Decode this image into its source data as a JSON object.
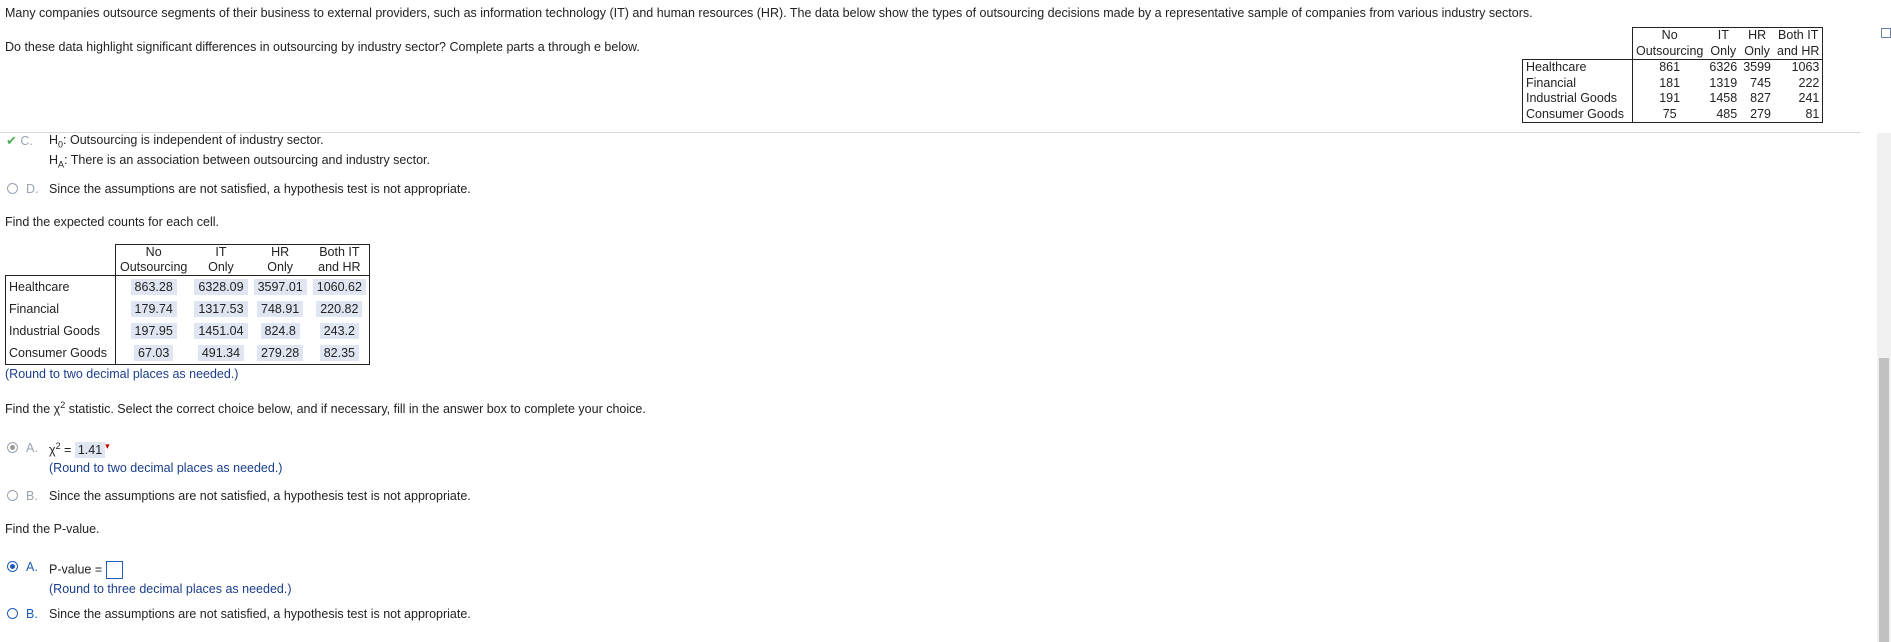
{
  "intro": "Many companies outsource segments of their business to external providers, such as information technology (IT) and human resources (HR). The data below show the types of outsourcing decisions made by a representative sample of companies from various industry sectors.",
  "question": "Do these data highlight significant differences in outsourcing by industry sector? Complete parts a through e below.",
  "data_table": {
    "headers": [
      [
        "No",
        "Outsourcing"
      ],
      [
        "IT",
        "Only"
      ],
      [
        "HR",
        "Only"
      ],
      [
        "Both IT",
        "and HR"
      ]
    ],
    "rows": [
      {
        "label": "Healthcare",
        "values": [
          "861",
          "6326",
          "3599",
          "1063"
        ]
      },
      {
        "label": "Financial",
        "values": [
          "181",
          "1319",
          "745",
          "222"
        ]
      },
      {
        "label": "Industrial Goods",
        "values": [
          "191",
          "1458",
          "827",
          "241"
        ]
      },
      {
        "label": "Consumer Goods",
        "values": [
          "75",
          "485",
          "279",
          "81"
        ]
      }
    ]
  },
  "hypothesis_options": {
    "C": {
      "letter": "C.",
      "h0_prefix": "H",
      "h0_sub": "0",
      "h0_text": ": Outsourcing is independent of industry sector.",
      "ha_prefix": "H",
      "ha_sub": "A",
      "ha_text": ": There is an association between outsourcing and industry sector."
    },
    "D": {
      "letter": "D.",
      "text": "Since the assumptions are not satisfied, a hypothesis test is not appropriate."
    }
  },
  "expected_prompt": "Find the expected counts for each cell.",
  "expected_table": {
    "headers": [
      [
        "No",
        "Outsourcing"
      ],
      [
        "IT",
        "Only"
      ],
      [
        "HR",
        "Only"
      ],
      [
        "Both IT",
        "and HR"
      ]
    ],
    "rows": [
      {
        "label": "Healthcare",
        "values": [
          "863.28",
          "6328.09",
          "3597.01",
          "1060.62"
        ]
      },
      {
        "label": "Financial",
        "values": [
          "179.74",
          "1317.53",
          "748.91",
          "220.82"
        ]
      },
      {
        "label": "Industrial Goods",
        "values": [
          "197.95",
          "1451.04",
          "824.8",
          "243.2"
        ]
      },
      {
        "label": "Consumer Goods",
        "values": [
          "67.03",
          "491.34",
          "279.28",
          "82.35"
        ]
      }
    ],
    "round_hint": "(Round to two decimal places as needed.)"
  },
  "chi_prompt_pre": "Find the ",
  "chi_symbol": "χ",
  "chi_sup": "2",
  "chi_prompt_post": " statistic. Select the correct choice below, and if necessary, fill in the answer box to complete your choice.",
  "chi_options": {
    "A": {
      "letter": "A.",
      "eq": " = ",
      "value": "1.41",
      "hint": "(Round to two decimal places as needed.)"
    },
    "B": {
      "letter": "B.",
      "text": "Since the assumptions are not satisfied, a hypothesis test is not appropriate."
    }
  },
  "pvalue_prompt": "Find the P-value.",
  "pvalue_options": {
    "A": {
      "letter": "A.",
      "label": "P-value =",
      "hint": "(Round to three decimal places as needed.)"
    },
    "B": {
      "letter": "B.",
      "text": "Since the assumptions are not satisfied, a hypothesis test is not appropriate."
    }
  }
}
